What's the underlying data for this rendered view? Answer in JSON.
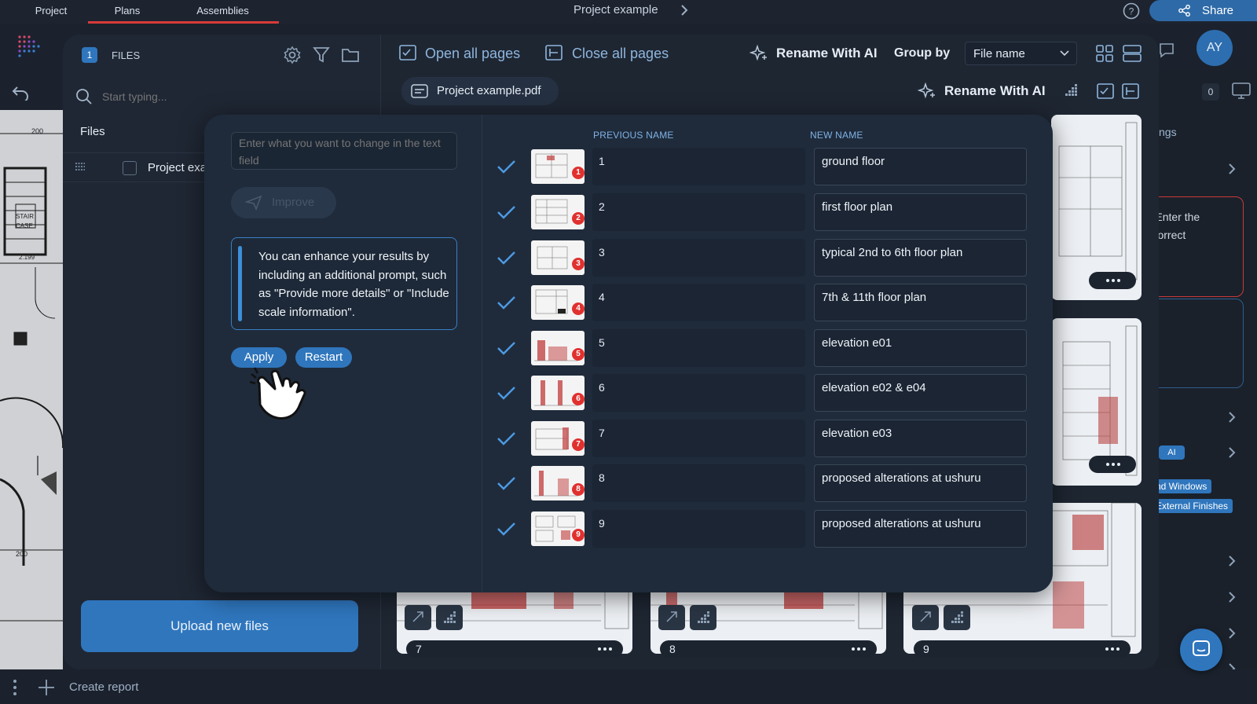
{
  "topbar": {
    "tabs": [
      "Project",
      "Plans",
      "Assemblies"
    ],
    "active_tab": "Plans",
    "title": "Project example",
    "share_label": "Share",
    "avatar_initials": "AY"
  },
  "files_panel": {
    "badge_count": "1",
    "header_label": "FILES",
    "search_placeholder": "Start typing...",
    "section_title": "Files",
    "file_item_label": "Project exa",
    "upload_button": "Upload new files"
  },
  "toolbar": {
    "open_all_pages": "Open all pages",
    "close_all_pages": "Close all pages",
    "rename_with_ai": "Rename With AI",
    "group_by_label": "Group by",
    "group_by_value": "File name",
    "file_tab": "Project example.pdf",
    "rename_with_ai_secondary": "Rename With AI",
    "right_counter": "0"
  },
  "right_panel": {
    "settings_tab": "Settings",
    "warning_text_line1": "ed. Enter the",
    "warning_text_line2": "he correct",
    "ai_badge": "AI",
    "tag1": "nd Windows",
    "tag2": "External Finishes"
  },
  "page_cards": [
    {
      "number": "7"
    },
    {
      "number": "8"
    },
    {
      "number": "9"
    }
  ],
  "bottom_bar": {
    "create_report": "Create report"
  },
  "rename_dialog": {
    "prompt_placeholder": "Enter what you want to change in the text field",
    "improve_button": "Improve",
    "hint_text": "You can enhance your results by including an additional prompt, such as \"Provide more details\" or \"Include scale information\".",
    "apply_button": "Apply",
    "restart_button": "Restart",
    "previous_name_header": "PREVIOUS NAME",
    "new_name_header": "NEW NAME",
    "rows": [
      {
        "badge": "1",
        "previous": "1",
        "new": "ground floor"
      },
      {
        "badge": "2",
        "previous": "2",
        "new": "first floor plan"
      },
      {
        "badge": "3",
        "previous": "3",
        "new": "typical 2nd to 6th floor plan"
      },
      {
        "badge": "4",
        "previous": "4",
        "new": "7th & 11th floor plan"
      },
      {
        "badge": "5",
        "previous": "5",
        "new": "elevation e01"
      },
      {
        "badge": "6",
        "previous": "6",
        "new": "elevation e02 & e04"
      },
      {
        "badge": "7",
        "previous": "7",
        "new": "elevation e03"
      },
      {
        "badge": "8",
        "previous": "8",
        "new": "proposed alterations at ushuru"
      },
      {
        "badge": "9",
        "previous": "9",
        "new": "proposed alterations at ushuru"
      }
    ]
  },
  "colors": {
    "accent": "#2f76bd",
    "danger": "#e0312f",
    "background": "#1c2330"
  }
}
